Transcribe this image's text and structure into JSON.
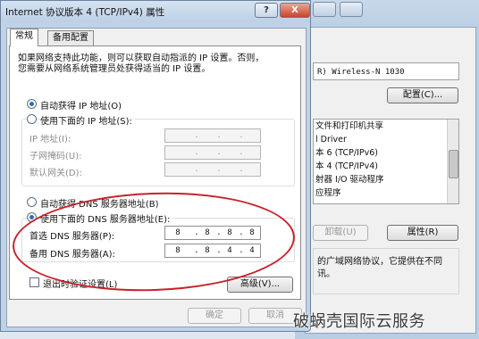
{
  "dialog": {
    "title": "Internet 协议版本 4 (TCP/IPv4) 属性",
    "help_label": "?",
    "close_label": "X",
    "tabs": [
      {
        "label": "常规"
      },
      {
        "label": "备用配置"
      }
    ],
    "description": "如果网络支持此功能，则可以获取自动指派的 IP 设置。否则，\n您需要从网络系统管理员处获得适当的 IP 设置。",
    "ip": {
      "auto_label": "自动获得 IP 地址(O)",
      "manual_label": "使用下面的 IP 地址(S):",
      "address_label": "IP 地址(I):",
      "mask_label": "子网掩码(U):",
      "gateway_label": "默认网关(D):",
      "dots": "."
    },
    "dns": {
      "auto_label": "自动获得 DNS 服务器地址(B)",
      "manual_label": "使用下面的 DNS 服务器地址(E):",
      "preferred_label": "首选 DNS 服务器(P):",
      "alternate_label": "备用 DNS 服务器(A):",
      "preferred_octets": [
        "8",
        "8",
        "8",
        "8"
      ],
      "alternate_octets": [
        "8",
        "8",
        "4",
        "4"
      ]
    },
    "validate_label": "退出时验证设置(L)",
    "advanced_label": "高级(V)...",
    "ok_label": "确定",
    "cancel_label": "取消"
  },
  "background_window": {
    "adapter_text": "R) Wireless-N 1030",
    "configure_label": "配置(C)...",
    "items": [
      "文件和打印机共享",
      "l Driver",
      "本 6 (TCP/IPv6)",
      "本 4 (TCP/IPv4)",
      "射器 I/O 驱动程序",
      "应程序"
    ],
    "uninstall_label": "卸载(U)",
    "properties_label": "属性(R)",
    "description": "的广域网络协议，它提供在不同\n讯。"
  },
  "watermark": "破蜗壳国际云服务"
}
